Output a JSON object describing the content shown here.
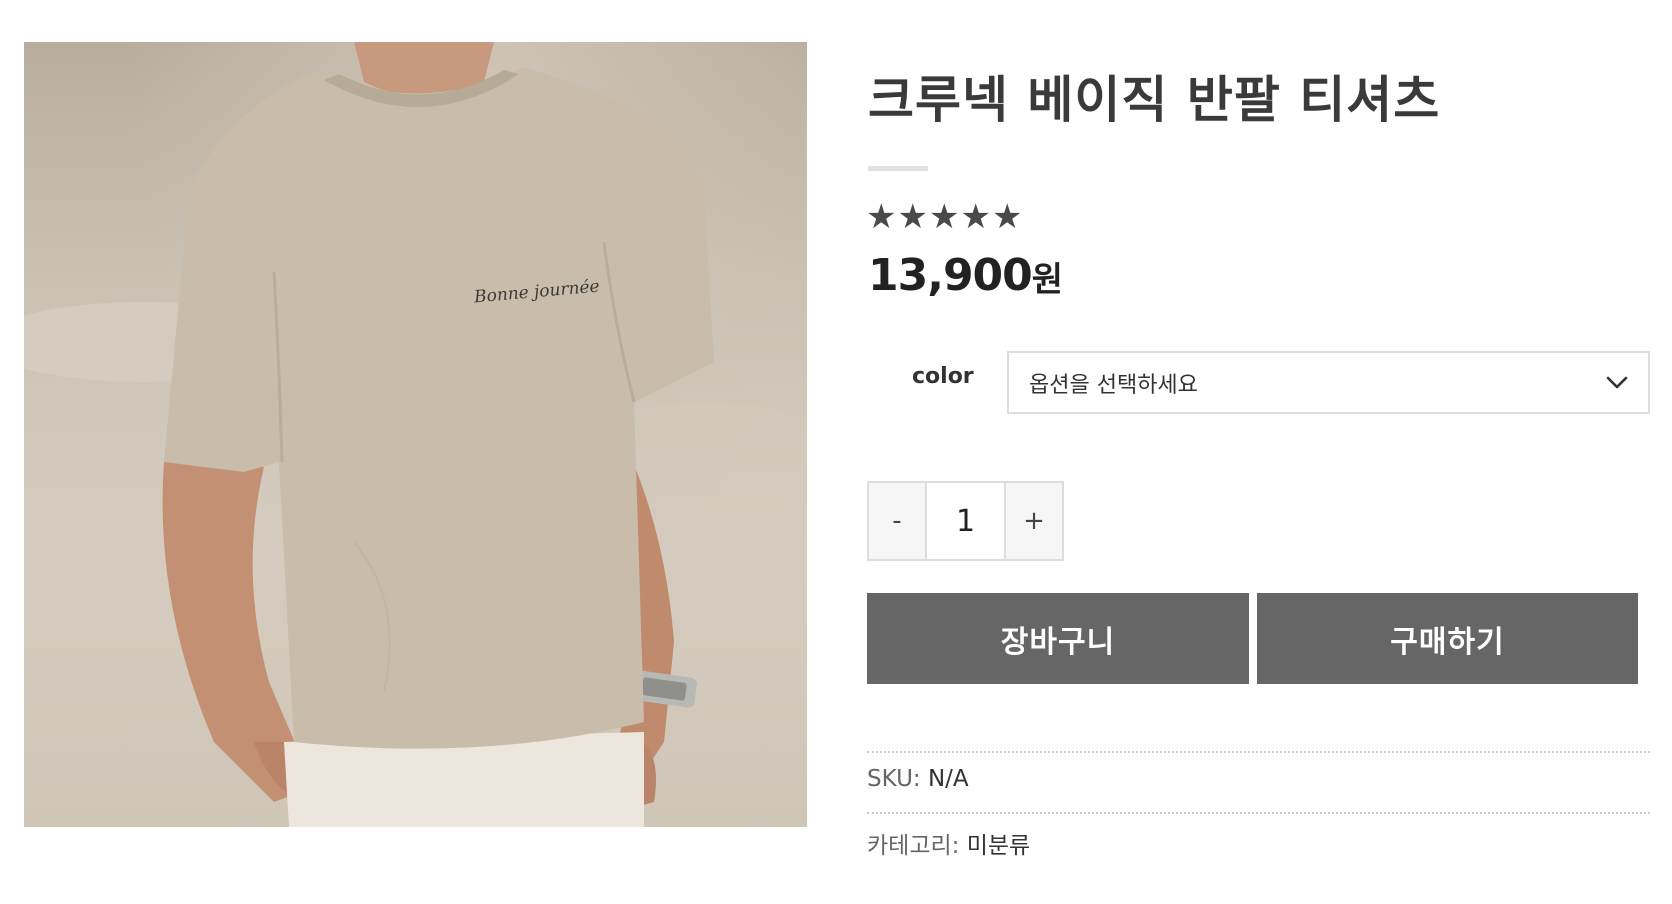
{
  "product": {
    "title": "크루넥 베이직 반팔 티셔츠",
    "rating": 5,
    "rating_max": 5,
    "price_amount": "13,900",
    "price_currency": "원",
    "image": {
      "print_text": "Bonne journée"
    }
  },
  "options": {
    "label": "color",
    "selected": "옵션을 선택하세요"
  },
  "quantity": {
    "minus": "-",
    "value": "1",
    "plus": "+"
  },
  "actions": {
    "cart_label": "장바구니",
    "buy_label": "구매하기"
  },
  "meta": {
    "sku_label": "SKU:",
    "sku_value": "N/A",
    "category_label": "카테고리:",
    "category_value": "미분류"
  },
  "colors": {
    "button_bg": "#666666",
    "star": "#4a4a4a",
    "tshirt": "#c9bcaa"
  }
}
